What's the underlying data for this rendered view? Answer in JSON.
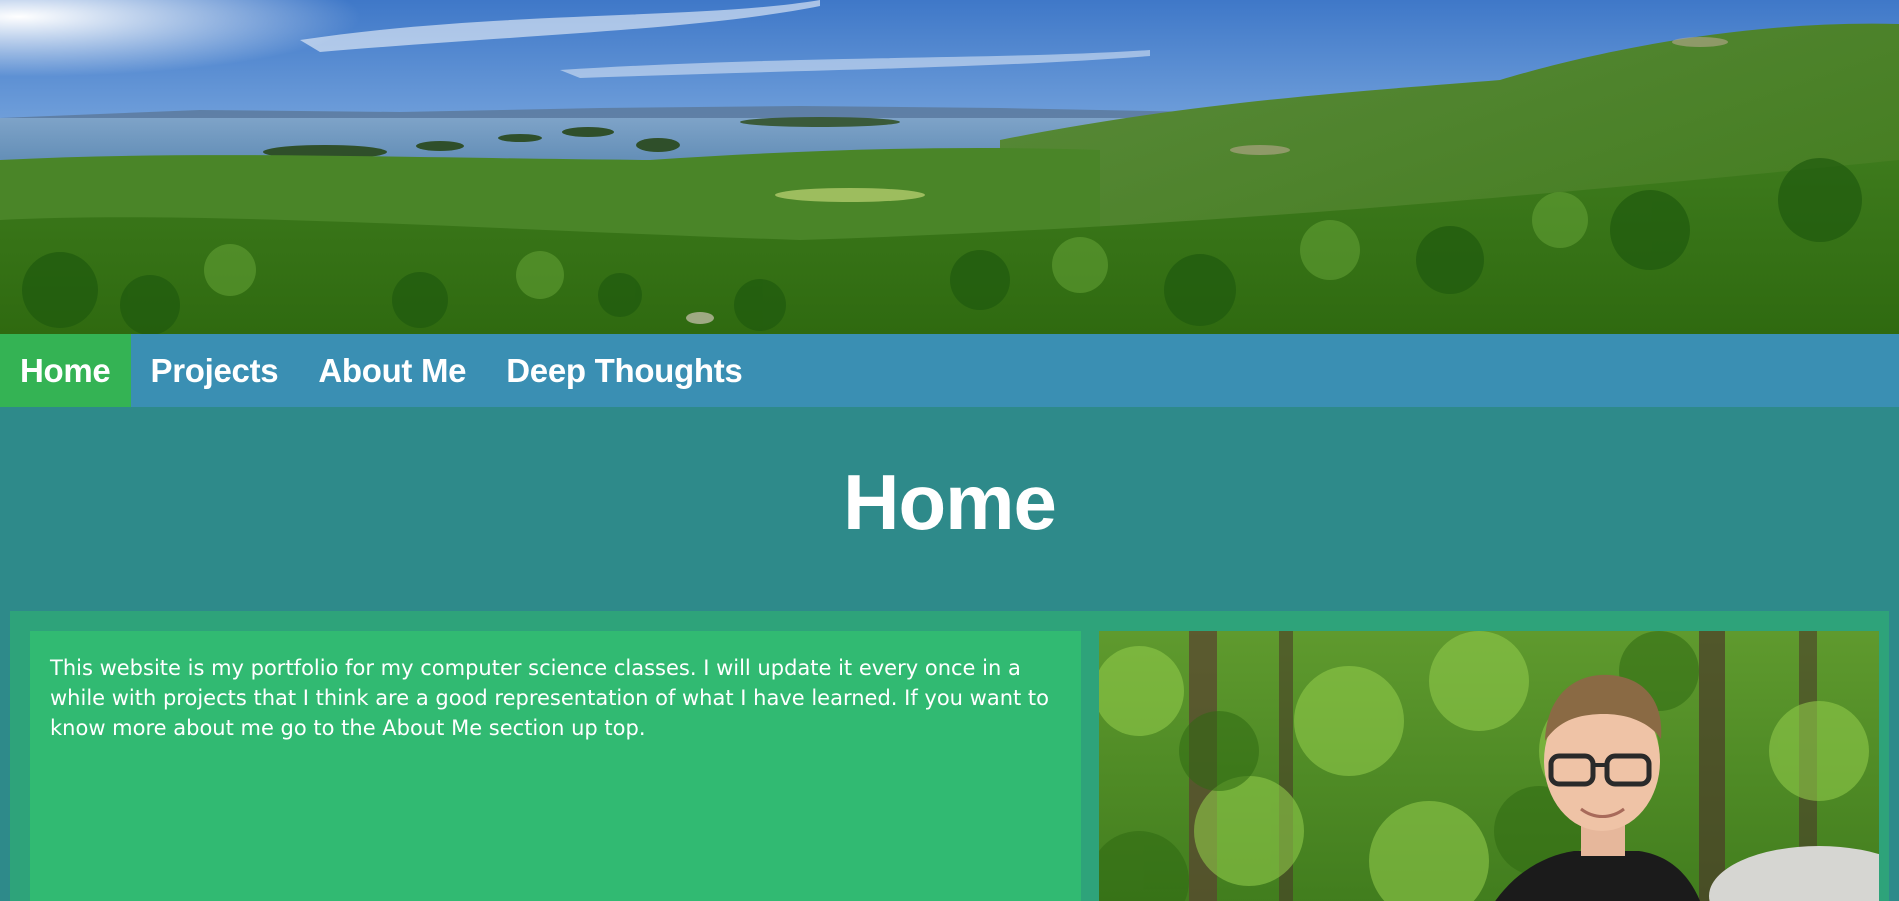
{
  "banner": {
    "image_alt": "Panoramic view of green forested mountains overlooking a bay with islands"
  },
  "nav": {
    "items": [
      {
        "label": "Home",
        "active": true
      },
      {
        "label": "Projects",
        "active": false
      },
      {
        "label": "About Me",
        "active": false
      },
      {
        "label": "Deep Thoughts",
        "active": false
      }
    ]
  },
  "main": {
    "title": "Home",
    "intro_text": "This website is my portfolio for my computer science classes. I will update it every once in a while with projects that I think are a good representation of what I have learned. If you want to know more about me go to the About Me section up top.",
    "photo_alt": "Portrait of a young man with glasses in a forest"
  },
  "colors": {
    "nav_bg": "#3a8fb3",
    "nav_active": "#34b354",
    "main_bg": "#2e8a8a",
    "card_frame": "#2ea37a",
    "card_text_bg": "#31ba72"
  }
}
